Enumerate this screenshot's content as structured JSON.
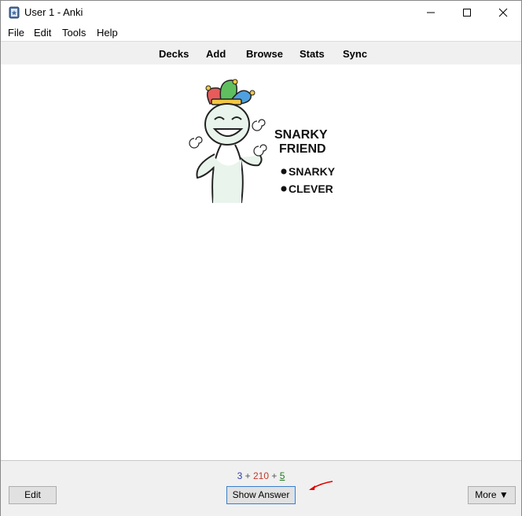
{
  "window": {
    "title": "User 1 - Anki"
  },
  "menu": [
    "File",
    "Edit",
    "Tools",
    "Help"
  ],
  "toolbar": [
    "Decks",
    "Add",
    "Browse",
    "Stats",
    "Sync"
  ],
  "card": {
    "image_text_title_line1": "SNARKY",
    "image_text_title_line2": "FRIEND",
    "image_text_bullet1": "SNARKY",
    "image_text_bullet2": "CLEVER"
  },
  "counts": {
    "new": "3",
    "learning": "210",
    "review": "5",
    "separator": "+"
  },
  "buttons": {
    "edit": "Edit",
    "show_answer": "Show Answer",
    "more": "More ▼"
  },
  "colors": {
    "new": "#3240a8",
    "learning": "#c0392b",
    "review": "#1d7a1d",
    "annotation_arrow": "#e00000"
  }
}
